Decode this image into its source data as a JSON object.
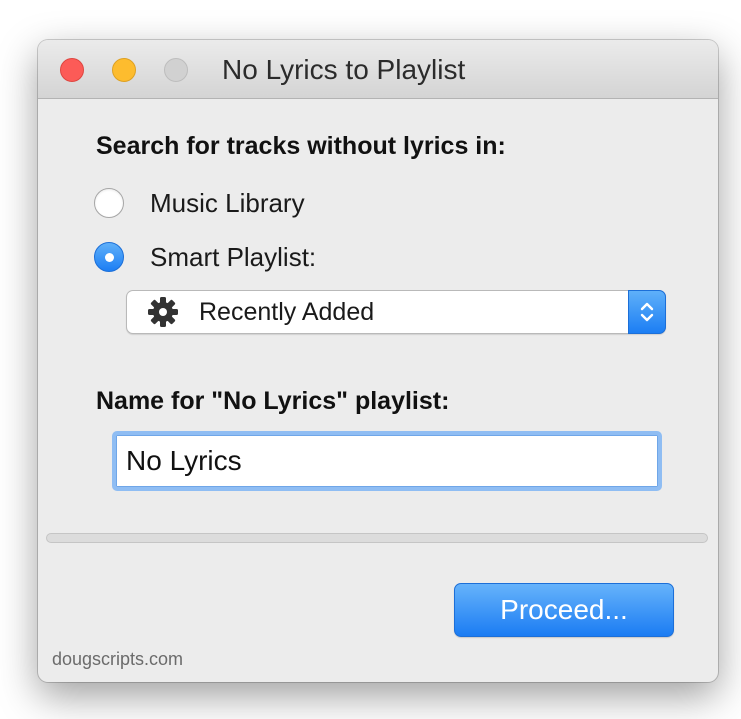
{
  "window": {
    "title": "No Lyrics to Playlist"
  },
  "search": {
    "heading": "Search for tracks without lyrics in:",
    "options": [
      {
        "label": "Music Library",
        "selected": false
      },
      {
        "label": "Smart Playlist:",
        "selected": true
      }
    ],
    "playlist_popup": {
      "icon": "gear-icon",
      "selected_value": "Recently Added"
    }
  },
  "name": {
    "heading": "Name for \"No Lyrics\" playlist:",
    "field_value": "No Lyrics"
  },
  "progress": {
    "fraction": 0
  },
  "actions": {
    "proceed_label": "Proceed..."
  },
  "footer": {
    "credit": "dougscripts.com"
  },
  "colors": {
    "accent": "#1b7cf3",
    "close": "#fc5b57",
    "minimize": "#fdbc2e",
    "zoom_disabled": "#d1d1d1",
    "window_bg": "#ececec"
  }
}
